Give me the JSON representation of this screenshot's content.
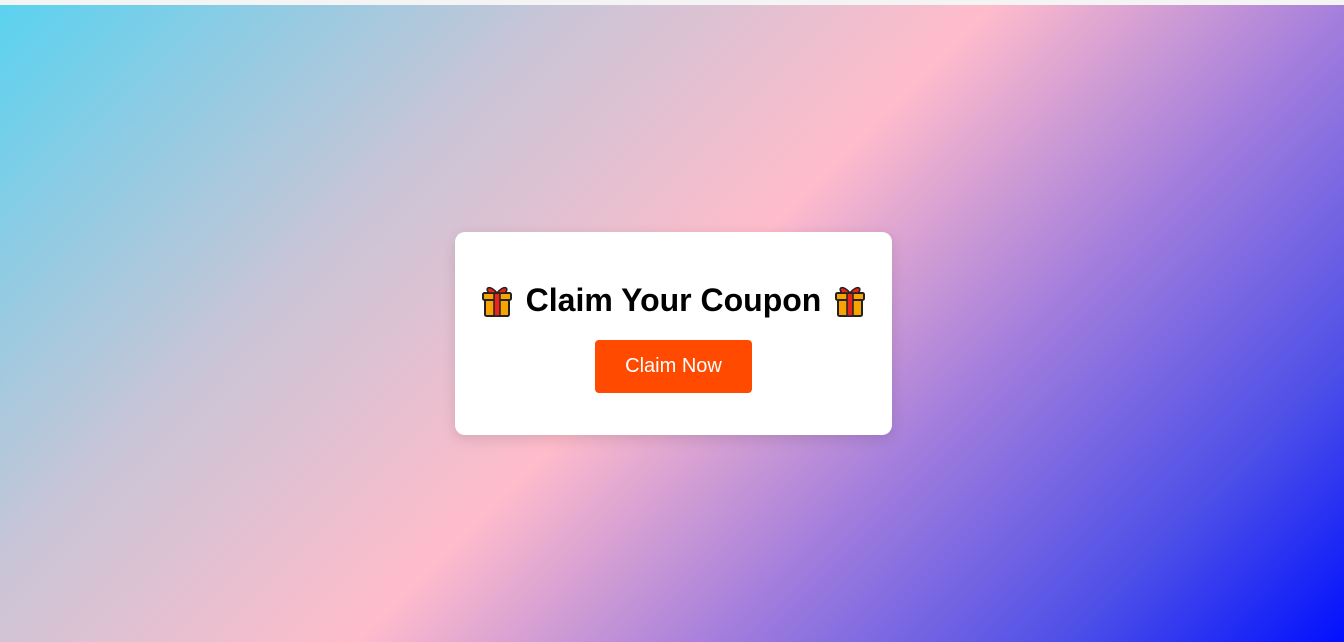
{
  "coupon_card": {
    "title": "Claim Your Coupon",
    "left_icon": "gift-icon",
    "right_icon": "gift-icon",
    "button_label": "Claim Now"
  },
  "colors": {
    "button_background": "#ff4a00",
    "button_text": "#ffffff",
    "card_background": "#ffffff",
    "gradient": [
      "#5ad2ef",
      "#ffbccb",
      "#0010fe"
    ]
  }
}
